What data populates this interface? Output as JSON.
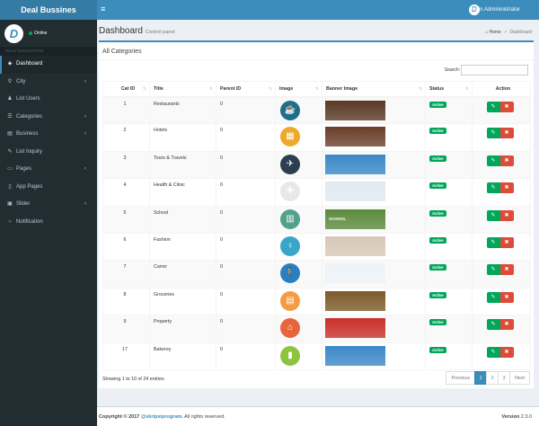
{
  "app": {
    "title": "Deal Bussines"
  },
  "header": {
    "menu_icon": "hamburger-icon",
    "user_name": "Main Admininistrator"
  },
  "sidebar": {
    "status": "Online",
    "section_header": "MAIN NAVIGATION",
    "items": [
      {
        "label": "Dashboard",
        "icon": "dashboard-icon",
        "glyph": "◈",
        "active": true,
        "has_children": false
      },
      {
        "label": "City",
        "icon": "map-pin-icon",
        "glyph": "⚲",
        "active": false,
        "has_children": true
      },
      {
        "label": "List Users",
        "icon": "user-icon",
        "glyph": "♟",
        "active": false,
        "has_children": false
      },
      {
        "label": "Categories",
        "icon": "list-icon",
        "glyph": "☰",
        "active": false,
        "has_children": true
      },
      {
        "label": "Business",
        "icon": "briefcase-icon",
        "glyph": "▤",
        "active": false,
        "has_children": true
      },
      {
        "label": "List Inquiry",
        "icon": "pencil-icon",
        "glyph": "✎",
        "active": false,
        "has_children": false
      },
      {
        "label": "Pages",
        "icon": "folder-icon",
        "glyph": "▭",
        "active": false,
        "has_children": true
      },
      {
        "label": "App Pages",
        "icon": "mobile-icon",
        "glyph": "▯",
        "active": false,
        "has_children": false
      },
      {
        "label": "Slider",
        "icon": "image-icon",
        "glyph": "▣",
        "active": false,
        "has_children": true
      },
      {
        "label": "Notification",
        "icon": "bell-icon",
        "glyph": "○",
        "active": false,
        "has_children": false
      }
    ]
  },
  "page": {
    "title": "Dashboard",
    "subtitle": "Control panel",
    "breadcrumb": {
      "home": "Home",
      "separator": ">",
      "current": "Dashboard"
    }
  },
  "box": {
    "title": "All Categories",
    "search_label": "Search:",
    "search_value": "",
    "columns": [
      "Cat ID",
      "Title",
      "Parent ID",
      "Image",
      "Banner Image",
      "Status",
      "Action"
    ],
    "rows": [
      {
        "id": "1",
        "title": "Restaurants",
        "parent": "0",
        "status": "Active",
        "img_color": "#1f6f8b",
        "img_glyph": "☕",
        "banner_color": "#5a3a26",
        "banner_text": "",
        "img_icon": "chef-hat-icon"
      },
      {
        "id": "2",
        "title": "Hotels",
        "parent": "0",
        "status": "Active",
        "img_color": "#f0a92c",
        "img_glyph": "▦",
        "banner_color": "#6b3f2a",
        "banner_text": "",
        "img_icon": "hotel-icon"
      },
      {
        "id": "3",
        "title": "Tours & Travels",
        "parent": "0",
        "status": "Active",
        "img_color": "#2c3e50",
        "img_glyph": "✈",
        "banner_color": "#3b88c8",
        "banner_text": "",
        "img_icon": "plane-icon"
      },
      {
        "id": "4",
        "title": "Health & Clinic",
        "parent": "0",
        "status": "Active",
        "img_color": "#e8e8e8",
        "img_glyph": "✚",
        "banner_color": "#dfe9f0",
        "banner_text": "",
        "img_icon": "first-aid-icon"
      },
      {
        "id": "5",
        "title": "School",
        "parent": "0",
        "status": "Active",
        "img_color": "#52a18b",
        "img_glyph": "▥",
        "banner_color": "#5b8a3c",
        "banner_text": "SCHOOL",
        "img_icon": "school-icon"
      },
      {
        "id": "6",
        "title": "Fashion",
        "parent": "0",
        "status": "Active",
        "img_color": "#38a5c9",
        "img_glyph": "♀",
        "banner_color": "#d8c7b8",
        "banner_text": "",
        "img_icon": "dress-icon"
      },
      {
        "id": "7",
        "title": "Carrer",
        "parent": "0",
        "status": "Active",
        "img_color": "#2b7fc0",
        "img_glyph": "🚶",
        "banner_color": "#eef3f8",
        "banner_text": "",
        "img_icon": "career-icon"
      },
      {
        "id": "8",
        "title": "Groceries",
        "parent": "0",
        "status": "Active",
        "img_color": "#f39c45",
        "img_glyph": "▤",
        "banner_color": "#7d5a2a",
        "banner_text": "",
        "img_icon": "basket-icon"
      },
      {
        "id": "9",
        "title": "Property",
        "parent": "0",
        "status": "Active",
        "img_color": "#e8643c",
        "img_glyph": "⌂",
        "banner_color": "#c9302c",
        "banner_text": "",
        "img_icon": "house-icon"
      },
      {
        "id": "17",
        "title": "Bakerey",
        "parent": "0",
        "status": "Active",
        "img_color": "#8cc43f",
        "img_glyph": "▮",
        "banner_color": "#3b88c8",
        "banner_text": "",
        "img_icon": "bakery-icon"
      }
    ],
    "entries_info": "Showing 1 to 10 of 24 entries",
    "pagination": {
      "previous": "Previous",
      "pages": [
        "1",
        "2",
        "3"
      ],
      "current": "1",
      "next": "Next"
    }
  },
  "footer": {
    "copyright_prefix": "Copyright © 2017",
    "copyright_link": "@skripsiprogram.",
    "copyright_suffix": "All rights reserved.",
    "version_label": "Version",
    "version_value": "2.3.0"
  },
  "colors": {
    "primary": "#3c8dbc",
    "sidebar": "#222d32",
    "success": "#00a65a",
    "danger": "#dd4b39"
  }
}
